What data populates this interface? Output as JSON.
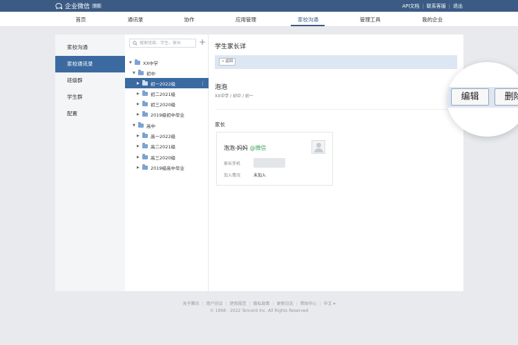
{
  "brand": {
    "name": "企业微信",
    "badge": "管理"
  },
  "top_links": [
    "API文档",
    "联系客服",
    "退出"
  ],
  "nav": [
    "首页",
    "通讯录",
    "协作",
    "应用管理",
    "家校沟通",
    "管理工具",
    "我的企业"
  ],
  "nav_active": "家校沟通",
  "left_menu": [
    "家校沟通",
    "家校通讯录",
    "班级群",
    "学生群",
    "配置"
  ],
  "left_menu_active": "家校通讯录",
  "search_placeholder": "搜索班级、学生、家长",
  "tree": [
    {
      "label": "XX中学",
      "expanded": true
    },
    {
      "label": "初中",
      "expanded": true
    },
    {
      "label": "初一2022级",
      "selected": true
    },
    {
      "label": "初二2021级"
    },
    {
      "label": "初三2020级"
    },
    {
      "label": "2019级初中毕业"
    },
    {
      "label": "高中",
      "expanded": true
    },
    {
      "label": "高一2022级"
    },
    {
      "label": "高二2021级"
    },
    {
      "label": "高三2020级"
    },
    {
      "label": "2019级高中毕业"
    }
  ],
  "detail": {
    "title": "学生家长详",
    "back_label": "返回",
    "edit_label": "编辑",
    "delete_label": "删除",
    "student_name": "泡泡",
    "path": "XX中学 / 初中 / 初一",
    "parents_label": "家长",
    "parent": {
      "name": "泡泡-妈妈",
      "wechat_tag": "@微信",
      "phone_label": "家长手机",
      "join_label": "加入情况",
      "join_status": "未加入"
    }
  },
  "footer_links": [
    "关于腾讯",
    "用户协议",
    "使用规范",
    "隐私政策",
    "更新日志",
    "帮助中心",
    "中文 ▾"
  ],
  "copyright": "© 1998 - 2022 Tencent Inc. All Rights Reserved",
  "colors": {
    "topbar": "#3b5b85",
    "selected": "#3b6aa0",
    "toolbar": "#dde7f3",
    "wechat": "#3aa55a"
  }
}
